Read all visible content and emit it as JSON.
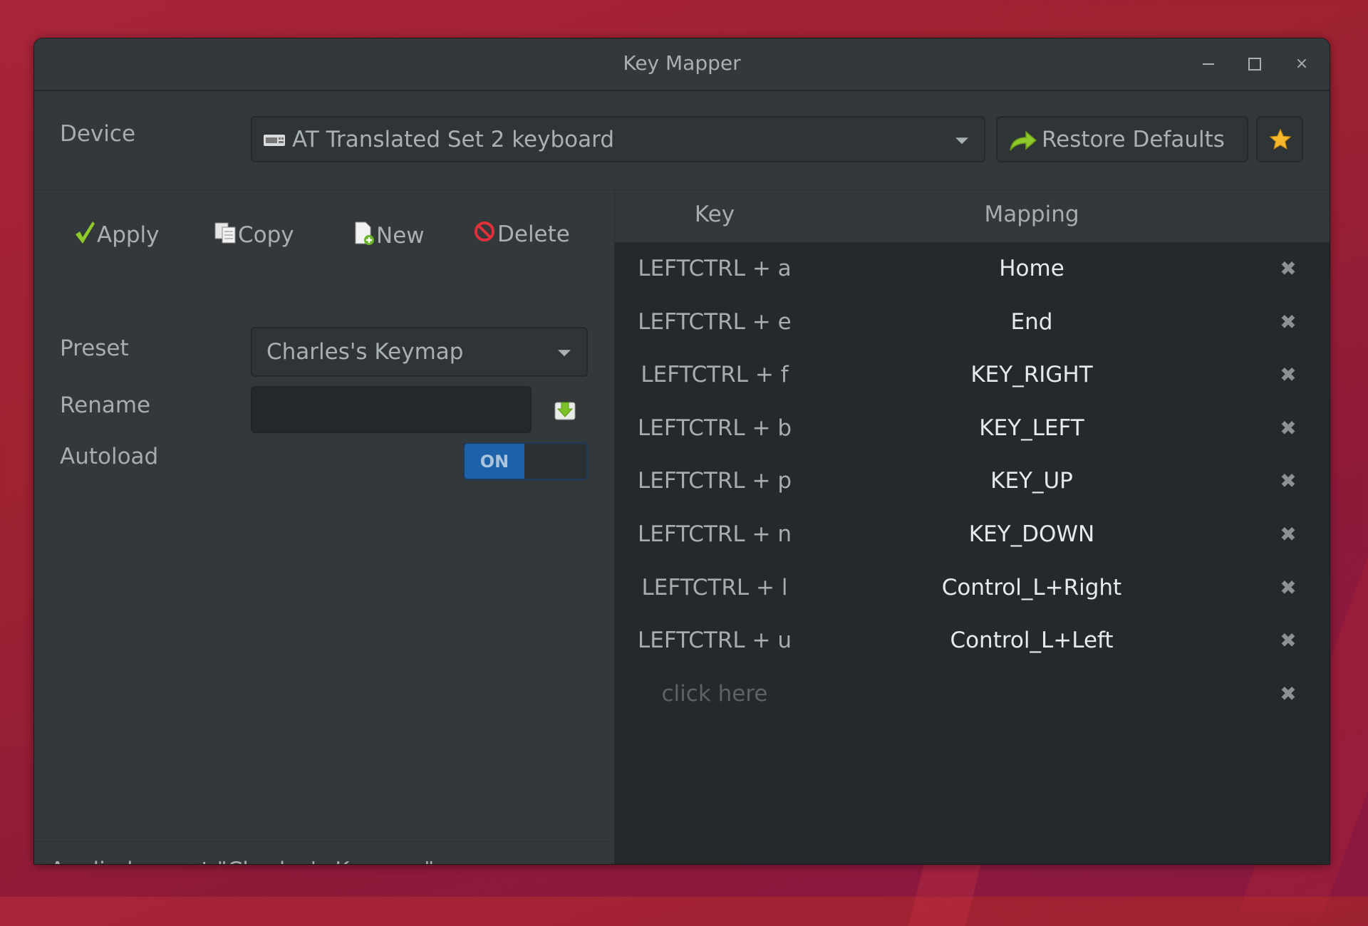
{
  "window": {
    "title": "Key Mapper",
    "controls": {
      "minimize": "minimize-icon",
      "maximize": "maximize-icon",
      "close": "close-icon"
    }
  },
  "device": {
    "label": "Device",
    "selected": "AT Translated Set 2 keyboard",
    "icon": "keyboard-icon",
    "restore_label": "Restore Defaults",
    "restore_icon": "redo-arrow-icon",
    "favorite_icon": "star-icon"
  },
  "toolbar": {
    "apply_label": "Apply",
    "copy_label": "Copy",
    "new_label": "New",
    "delete_label": "Delete"
  },
  "preset": {
    "label": "Preset",
    "selected": "Charles's Keymap"
  },
  "rename": {
    "label": "Rename",
    "value": "",
    "save_icon": "save-icon"
  },
  "autoload": {
    "label": "Autoload",
    "state": "ON",
    "enabled": true
  },
  "status": {
    "text": "Applied preset \"Charles's Keymap\""
  },
  "table": {
    "headers": {
      "key": "Key",
      "mapping": "Mapping"
    },
    "rows": [
      {
        "key": "LEFTCTRL + a",
        "mapping": "Home"
      },
      {
        "key": "LEFTCTRL + e",
        "mapping": "End"
      },
      {
        "key": "LEFTCTRL + f",
        "mapping": "KEY_RIGHT"
      },
      {
        "key": "LEFTCTRL + b",
        "mapping": "KEY_LEFT"
      },
      {
        "key": "LEFTCTRL + p",
        "mapping": "KEY_UP"
      },
      {
        "key": "LEFTCTRL + n",
        "mapping": "KEY_DOWN"
      },
      {
        "key": "LEFTCTRL + l",
        "mapping": "Control_L+Right"
      },
      {
        "key": "LEFTCTRL + u",
        "mapping": "Control_L+Left"
      }
    ],
    "new_row_placeholder": "click here",
    "delete_glyph": "✖"
  },
  "colors": {
    "switch_on": "#1d61a8",
    "window_bg": "#33383b",
    "table_bg": "#25292c"
  }
}
